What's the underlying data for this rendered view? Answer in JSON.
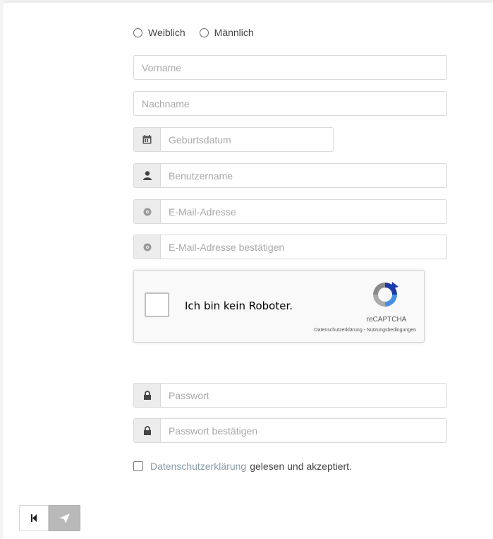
{
  "gender": {
    "options": [
      "Weiblich",
      "Männlich"
    ]
  },
  "fields": {
    "vorname": {
      "placeholder": "Vorname"
    },
    "nachname": {
      "placeholder": "Nachname"
    },
    "geburtsdatum": {
      "placeholder": "Geburtsdatum",
      "icon": "calendar-icon"
    },
    "benutzername": {
      "placeholder": "Benutzername",
      "icon": "user-icon"
    },
    "email": {
      "placeholder": "E-Mail-Adresse",
      "icon": "at-icon"
    },
    "email_confirm": {
      "placeholder": "E-Mail-Adresse bestätigen",
      "icon": "at-icon"
    },
    "passwort": {
      "placeholder": "Passwort",
      "icon": "lock-icon"
    },
    "passwort_confirm": {
      "placeholder": "Passwort bestätigen",
      "icon": "lock-icon"
    }
  },
  "recaptcha": {
    "label": "Ich bin kein Roboter.",
    "brand": "reCAPTCHA",
    "terms": "Datenschutzerklärung - Nutzungsbedingungen"
  },
  "privacy": {
    "link": "Datenschutzerklärung",
    "rest": "gelesen und akzeptiert."
  },
  "colors": {
    "addon_bg": "#ececec",
    "border": "#d9d9d9",
    "placeholder": "#a8a8a8",
    "link": "#8a9aa8",
    "send_button": "#b9b9b9",
    "recaptcha_blue": "#4a90e2"
  }
}
